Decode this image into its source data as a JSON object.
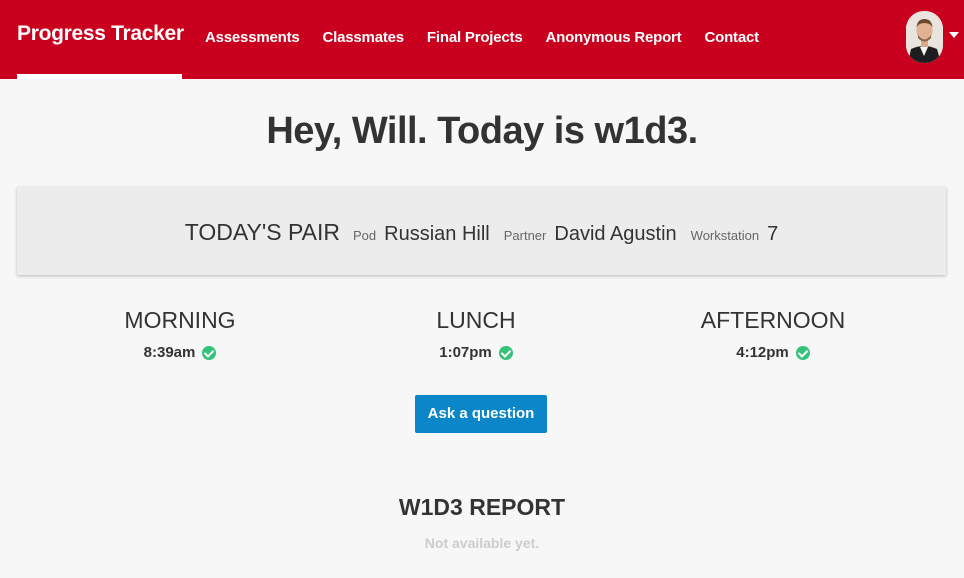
{
  "nav": {
    "brand": "Progress Tracker",
    "links": [
      "Assessments",
      "Classmates",
      "Final Projects",
      "Anonymous Report",
      "Contact"
    ]
  },
  "greeting": "Hey, Will. Today is w1d3.",
  "pair": {
    "title": "TODAY'S PAIR",
    "pod_label": "Pod",
    "pod": "Russian Hill",
    "partner_label": "Partner",
    "partner": "David Agustin",
    "workstation_label": "Workstation",
    "workstation": "7"
  },
  "checkins": [
    {
      "title": "MORNING",
      "time": "8:39am"
    },
    {
      "title": "LUNCH",
      "time": "1:07pm"
    },
    {
      "title": "AFTERNOON",
      "time": "4:12pm"
    }
  ],
  "ask_button": "Ask a question",
  "report": {
    "title": "W1D3 REPORT",
    "status": "Not available yet."
  },
  "colors": {
    "nav_bg": "#c9001e",
    "button_bg": "#0a86c9",
    "check": "#33c27a"
  },
  "icons": [
    "avatar",
    "caret-down-icon",
    "check-circle-icon"
  ]
}
